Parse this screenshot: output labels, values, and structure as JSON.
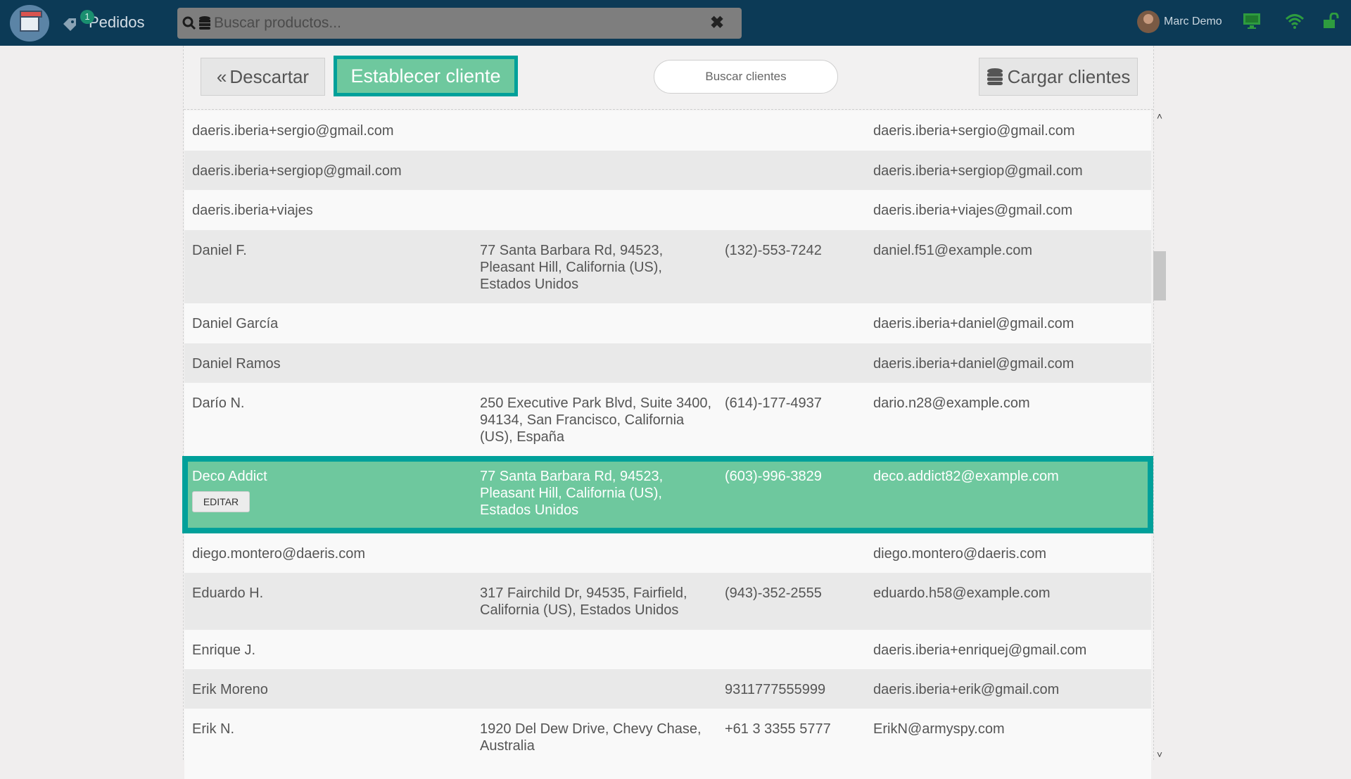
{
  "header": {
    "orders_label": "Pedidos",
    "orders_count": "1",
    "product_search_placeholder": "Buscar productos...",
    "user_name": "Marc Demo"
  },
  "toolbar": {
    "discard_label": "Descartar",
    "set_customer_label": "Establecer cliente",
    "customer_search_placeholder": "Buscar clientes",
    "load_customers_label": "Cargar clientes"
  },
  "customers": [
    {
      "name": "daeris.iberia+sergio@gmail.com",
      "address": "",
      "phone": "",
      "email": "daeris.iberia+sergio@gmail.com"
    },
    {
      "name": "daeris.iberia+sergiop@gmail.com",
      "address": "",
      "phone": "",
      "email": "daeris.iberia+sergiop@gmail.com"
    },
    {
      "name": "daeris.iberia+viajes",
      "address": "",
      "phone": "",
      "email": "daeris.iberia+viajes@gmail.com"
    },
    {
      "name": "Daniel F.",
      "address": "77 Santa Barbara Rd, 94523, Pleasant Hill, California (US), Estados Unidos",
      "phone": "(132)-553-7242",
      "email": "daniel.f51@example.com"
    },
    {
      "name": "Daniel García",
      "address": "",
      "phone": "",
      "email": "daeris.iberia+daniel@gmail.com"
    },
    {
      "name": "Daniel Ramos",
      "address": "",
      "phone": "",
      "email": "daeris.iberia+daniel@gmail.com"
    },
    {
      "name": "Darío N.",
      "address": "250 Executive Park Blvd, Suite 3400, 94134, San Francisco, California (US), España",
      "phone": "(614)-177-4937",
      "email": "dario.n28@example.com"
    },
    {
      "name": "Deco Addict",
      "address": "77 Santa Barbara Rd, 94523, Pleasant Hill, California (US), Estados Unidos",
      "phone": "(603)-996-3829",
      "email": "deco.addict82@example.com",
      "edit_label": "EDITAR"
    },
    {
      "name": "diego.montero@daeris.com",
      "address": "",
      "phone": "",
      "email": "diego.montero@daeris.com"
    },
    {
      "name": "Eduardo H.",
      "address": "317 Fairchild Dr, 94535, Fairfield, California (US), Estados Unidos",
      "phone": "(943)-352-2555",
      "email": "eduardo.h58@example.com"
    },
    {
      "name": "Enrique J.",
      "address": "",
      "phone": "",
      "email": "daeris.iberia+enriquej@gmail.com"
    },
    {
      "name": "Erik Moreno",
      "address": "",
      "phone": "9311777555999",
      "email": "daeris.iberia+erik@gmail.com"
    },
    {
      "name": "Erik N.",
      "address": "1920 Del Dew Drive, Chevy Chase, Australia",
      "phone": "+61 3 3355 5777",
      "email": "ErikN@armyspy.com"
    }
  ],
  "colors": {
    "topbar": "#0c3a56",
    "accent_green": "#6ec89e",
    "accent_teal": "#00a09a",
    "status_green": "#2e9c3f"
  }
}
